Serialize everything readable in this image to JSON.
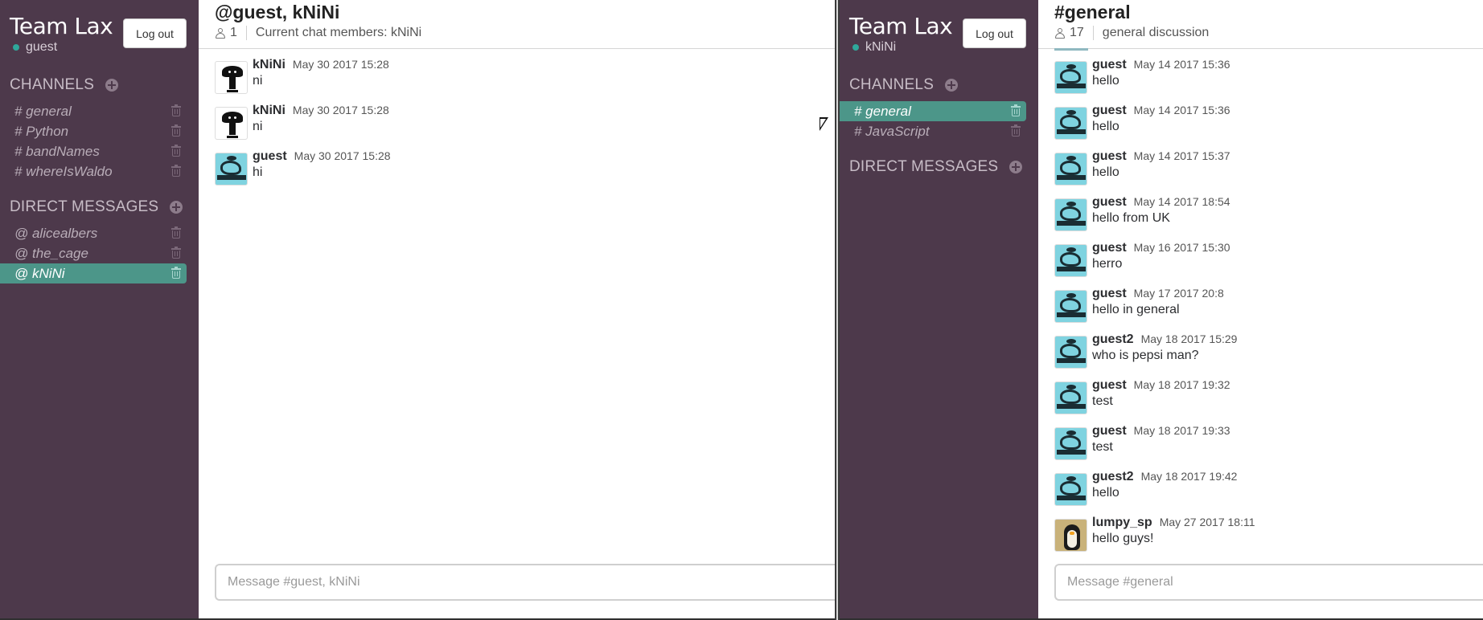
{
  "left": {
    "sidebar": {
      "team_name": "Team Lax",
      "user": "guest",
      "logout_label": "Log out",
      "channels_title": "CHANNELS",
      "channels": [
        {
          "label": "# general",
          "active": false
        },
        {
          "label": "# Python",
          "active": false
        },
        {
          "label": "# bandNames",
          "active": false
        },
        {
          "label": "# whereIsWaldo",
          "active": false
        }
      ],
      "dm_title": "DIRECT MESSAGES",
      "dms": [
        {
          "label": "@ alicealbers",
          "active": false
        },
        {
          "label": "@ the_cage",
          "active": false
        },
        {
          "label": "@ kNiNi",
          "active": true
        }
      ]
    },
    "header": {
      "title": "@guest, kNiNi",
      "member_count": "1",
      "description": "Current chat members: kNiNi"
    },
    "messages": [
      {
        "author": "kNiNi",
        "time": "May 30 2017 15:28",
        "text": "ni",
        "avatar": "tree"
      },
      {
        "author": "kNiNi",
        "time": "May 30 2017 15:28",
        "text": "ni",
        "avatar": "tree"
      },
      {
        "author": "guest",
        "time": "May 30 2017 15:28",
        "text": "hi",
        "avatar": "raptor"
      }
    ],
    "composer_placeholder": "Message #guest, kNiNi"
  },
  "right": {
    "sidebar": {
      "team_name": "Team Lax",
      "user": "kNiNi",
      "logout_label": "Log out",
      "channels_title": "CHANNELS",
      "channels": [
        {
          "label": "# general",
          "active": true
        },
        {
          "label": "# JavaScript",
          "active": false
        }
      ],
      "dm_title": "DIRECT MESSAGES",
      "dms": []
    },
    "header": {
      "title": "#general",
      "member_count": "17",
      "description": "general discussion"
    },
    "messages": [
      {
        "author": "guest",
        "time": "May 14 2017 15:36",
        "text": "hello",
        "avatar": "raptor"
      },
      {
        "author": "guest",
        "time": "May 14 2017 15:36",
        "text": "hello",
        "avatar": "raptor"
      },
      {
        "author": "guest",
        "time": "May 14 2017 15:37",
        "text": "hello",
        "avatar": "raptor"
      },
      {
        "author": "guest",
        "time": "May 14 2017 18:54",
        "text": "hello from UK",
        "avatar": "raptor"
      },
      {
        "author": "guest",
        "time": "May 16 2017 15:30",
        "text": "herro",
        "avatar": "raptor"
      },
      {
        "author": "guest",
        "time": "May 17 2017 20:8",
        "text": "hello in general",
        "avatar": "raptor"
      },
      {
        "author": "guest2",
        "time": "May 18 2017 15:29",
        "text": "who is pepsi man?",
        "avatar": "raptor"
      },
      {
        "author": "guest",
        "time": "May 18 2017 19:32",
        "text": "test",
        "avatar": "raptor"
      },
      {
        "author": "guest",
        "time": "May 18 2017 19:33",
        "text": "test",
        "avatar": "raptor"
      },
      {
        "author": "guest2",
        "time": "May 18 2017 19:42",
        "text": "hello",
        "avatar": "raptor"
      },
      {
        "author": "lumpy_sp",
        "time": "May 27 2017 18:11",
        "text": "hello guys!",
        "avatar": "penguin"
      }
    ],
    "composer_placeholder": "Message #general"
  },
  "colors": {
    "sidebar_bg": "#4d394b",
    "active_item": "#4c9689",
    "presence_dot": "#2fa89b"
  },
  "icons": {
    "add": "plus-circle-icon",
    "delete": "trash-icon",
    "members": "person-icon",
    "presence": "status-dot-icon"
  }
}
